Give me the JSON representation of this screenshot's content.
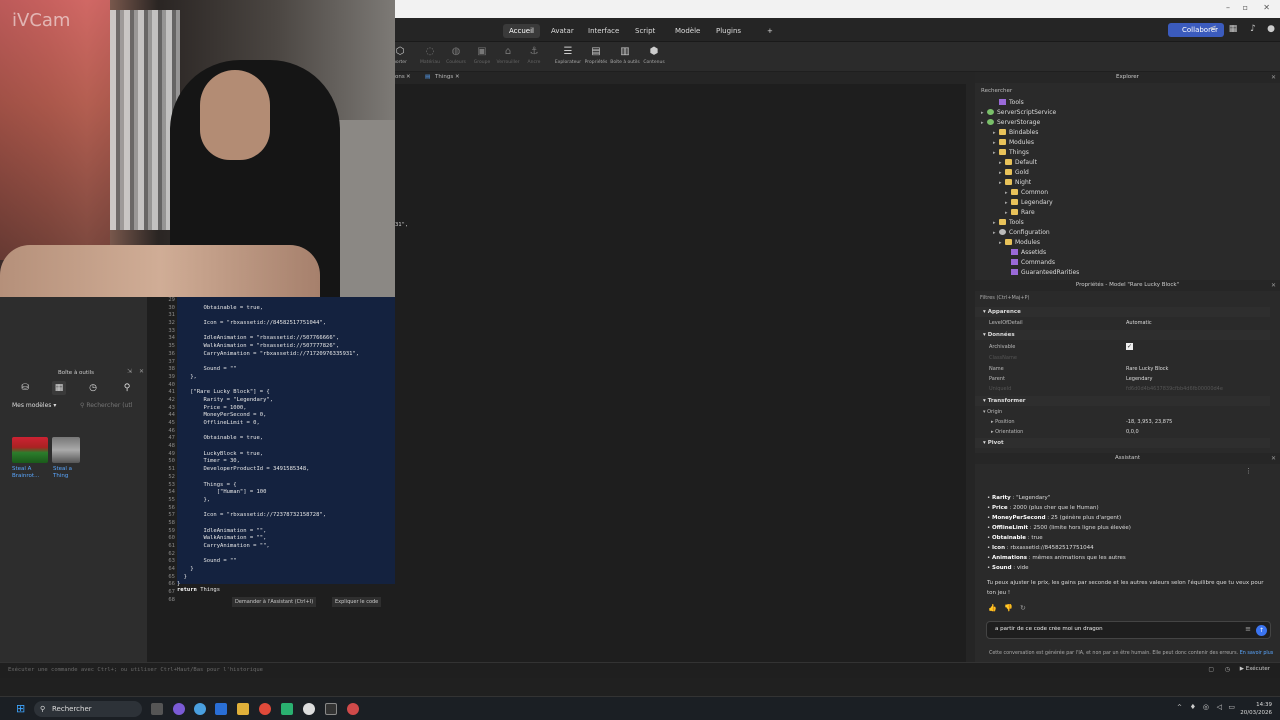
{
  "webcam": {
    "brand": "iVCam"
  },
  "menubar": {
    "tabs": [
      "Accueil",
      "Avatar",
      "Interface",
      "Script",
      "Modèle",
      "Plugins",
      "+"
    ],
    "collaborate": "Collaborer"
  },
  "toolbar": {
    "tools": [
      "porter",
      "Matériau",
      "Couleurs",
      "Groupe",
      "Verrouiller",
      "Ancre",
      "Explorateur",
      "Propriétés",
      "Boîte à outils",
      "Contenus"
    ]
  },
  "doctabs": {
    "tab1": "ons",
    "tab2": "Things"
  },
  "editor": {
    "stray_text": "31\",",
    "gutter": [
      "29",
      "30",
      "31",
      "32",
      "33",
      "34",
      "35",
      "36",
      "37",
      "38",
      "39",
      "40",
      "41",
      "42",
      "43",
      "44",
      "45",
      "46",
      "47",
      "48",
      "49",
      "50",
      "51",
      "52",
      "53",
      "54",
      "55",
      "56",
      "57",
      "58",
      "59",
      "60",
      "61",
      "62",
      "63",
      "64",
      "65",
      "66",
      "67",
      "68"
    ],
    "lines": [
      "",
      "        Obtainable = true,",
      "",
      "        Icon = \"rbxassetid://84582517751044\",",
      "",
      "        IdleAnimation = \"rbxassetid://507766666\",",
      "        WalkAnimation = \"rbxassetid://507777826\",",
      "        CarryAnimation = \"rbxassetid://71720976335931\",",
      "",
      "        Sound = \"\"",
      "    },",
      "",
      "    [\"Rare Lucky Block\"] = {",
      "        Rarity = \"Legendary\",",
      "        Price = 1000,",
      "        MoneyPerSecond = 0,",
      "        OfflineLimit = 0,",
      "",
      "        Obtainable = true,",
      "",
      "        LuckyBlock = true,",
      "        Timer = 30,",
      "        DeveloperProductId = 3491585348,",
      "",
      "        Things = {",
      "            [\"Human\"] = 100",
      "        },",
      "",
      "        Icon = \"rbxassetid://72378732158728\",",
      "",
      "        IdleAnimation = \"\",",
      "        WalkAnimation = \"\",",
      "        CarryAnimation = \"\",",
      "",
      "        Sound = \"\"",
      "    }",
      "  }",
      "}"
    ],
    "return_line": "return Things",
    "ask_assistant": "Demander à l'Assistant (Ctrl+I)",
    "explain_code": "Expliquer le code"
  },
  "toolbox": {
    "title": "Boîte à outils",
    "select": "Mes modèles",
    "search_placeholder": "Rechercher (utl",
    "items": [
      "Steal A Brainrot...",
      "Steal a Thing"
    ]
  },
  "explorer": {
    "title": "Explorer",
    "search": "Rechercher",
    "tree": [
      "Tools",
      "ServerScriptService",
      "ServerStorage",
      "Bindables",
      "Modules",
      "Things",
      "Default",
      "Gold",
      "Night",
      "Common",
      "Legendary",
      "Rare",
      "Tools",
      "Configuration",
      "Modules",
      "AssetIds",
      "Commands",
      "GuaranteedRarities"
    ]
  },
  "properties": {
    "title": "Propriétés - Model \"Rare Lucky Block\"",
    "filter": "Filtres (Ctrl+Maj+P)",
    "sections": [
      "Apparence",
      "Données",
      "Transformer",
      "Pivot"
    ],
    "level_of_detail": {
      "name": "LevelOfDetail",
      "value": "Automatic"
    },
    "archivable": {
      "name": "Archivable"
    },
    "class_name": "ClassName",
    "name": {
      "name": "Name",
      "value": "Rare Lucky Block"
    },
    "parent": {
      "name": "Parent",
      "value": "Legendary"
    },
    "unique_id": "UniqueId",
    "unique_id_value": "fd6d0d4b4637839cfbb4d6fb00000d4e",
    "origin": "Origin",
    "position": {
      "name": "Position",
      "value": "-18, 3,953, 23,875"
    },
    "orientation": {
      "name": "Orientation",
      "value": "0,0,0"
    }
  },
  "assistant": {
    "title": "Assistant",
    "bullets": [
      {
        "k": "Rarity",
        "v": " : \"Legendary\""
      },
      {
        "k": "Price",
        "v": " : 2000 (plus cher que le Human)"
      },
      {
        "k": "MoneyPerSecond",
        "v": " : 25 (génère plus d'argent)"
      },
      {
        "k": "OfflineLimit",
        "v": " : 2500 (limite hors ligne plus élevée)"
      },
      {
        "k": "Obtainable",
        "v": " : true"
      },
      {
        "k": "Icon",
        "v": " : rbxassetid://84582517751044"
      },
      {
        "k": "Animations",
        "v": " : mêmes animations que les autres"
      },
      {
        "k": "Sound",
        "v": " : vide"
      }
    ],
    "paragraph": "Tu peux ajuster le prix, les gains par seconde et les autres valeurs selon l'équilibre que tu veux pour ton jeu !",
    "input_value": "a partir de ce code crée moi un dragon",
    "disclaimer": "Cette conversation est générée par l'IA, et non par un être humain. Elle peut donc contenir des erreurs.",
    "learn_more": "En savoir plus"
  },
  "command_bar": {
    "placeholder": "Exécuter une commande avec Ctrl+; ou utiliser Ctrl+Haut/Bas pour l'historique",
    "run": "Exécuter"
  },
  "taskbar": {
    "search": "Rechercher",
    "time": "14:39",
    "date": "20/03/2026"
  },
  "colors": {
    "accent": "#3b5bbd",
    "send": "#3b74f0",
    "code_selection": "#14223f"
  }
}
